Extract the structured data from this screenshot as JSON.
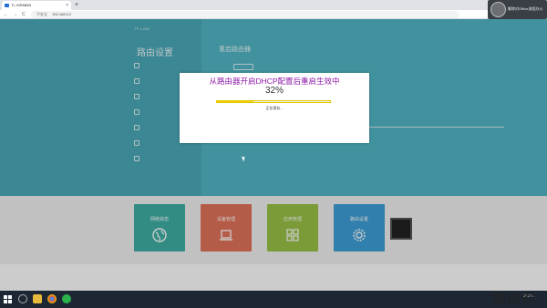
{
  "browser": {
    "tab_title": "TL-WR886N",
    "new_tab": "+",
    "close": "×",
    "nav_back": "←",
    "nav_forward": "→",
    "nav_reload": "C",
    "security": "不安全",
    "url": "192.168.0.2"
  },
  "chat_overlay": {
    "name": "解除对Office流程办公"
  },
  "router_page": {
    "brand": "TP-LINK",
    "sidebar_title": "路由设置",
    "top_links": "",
    "content_title": "重启路由器",
    "menu_items": [
      "",
      "",
      "",
      "",
      "",
      "",
      ""
    ],
    "tiles": [
      {
        "label": "网络状态",
        "color": "#3fb0a6",
        "icon": "globe-icon"
      },
      {
        "label": "设备管理",
        "color": "#e3735a",
        "icon": "laptop-icon"
      },
      {
        "label": "应用管理",
        "color": "#9ac246",
        "icon": "apps-icon"
      },
      {
        "label": "路由设置",
        "color": "#3d9fd8",
        "icon": "gear-icon"
      }
    ]
  },
  "dialog": {
    "title": "从路由器开启DHCP配置后重启生效中",
    "percent_text": "32%",
    "progress": 0.32,
    "status": "正在保存..."
  },
  "taskbar": {
    "time": "",
    "date": "2022/..."
  },
  "watermark": "路由网"
}
